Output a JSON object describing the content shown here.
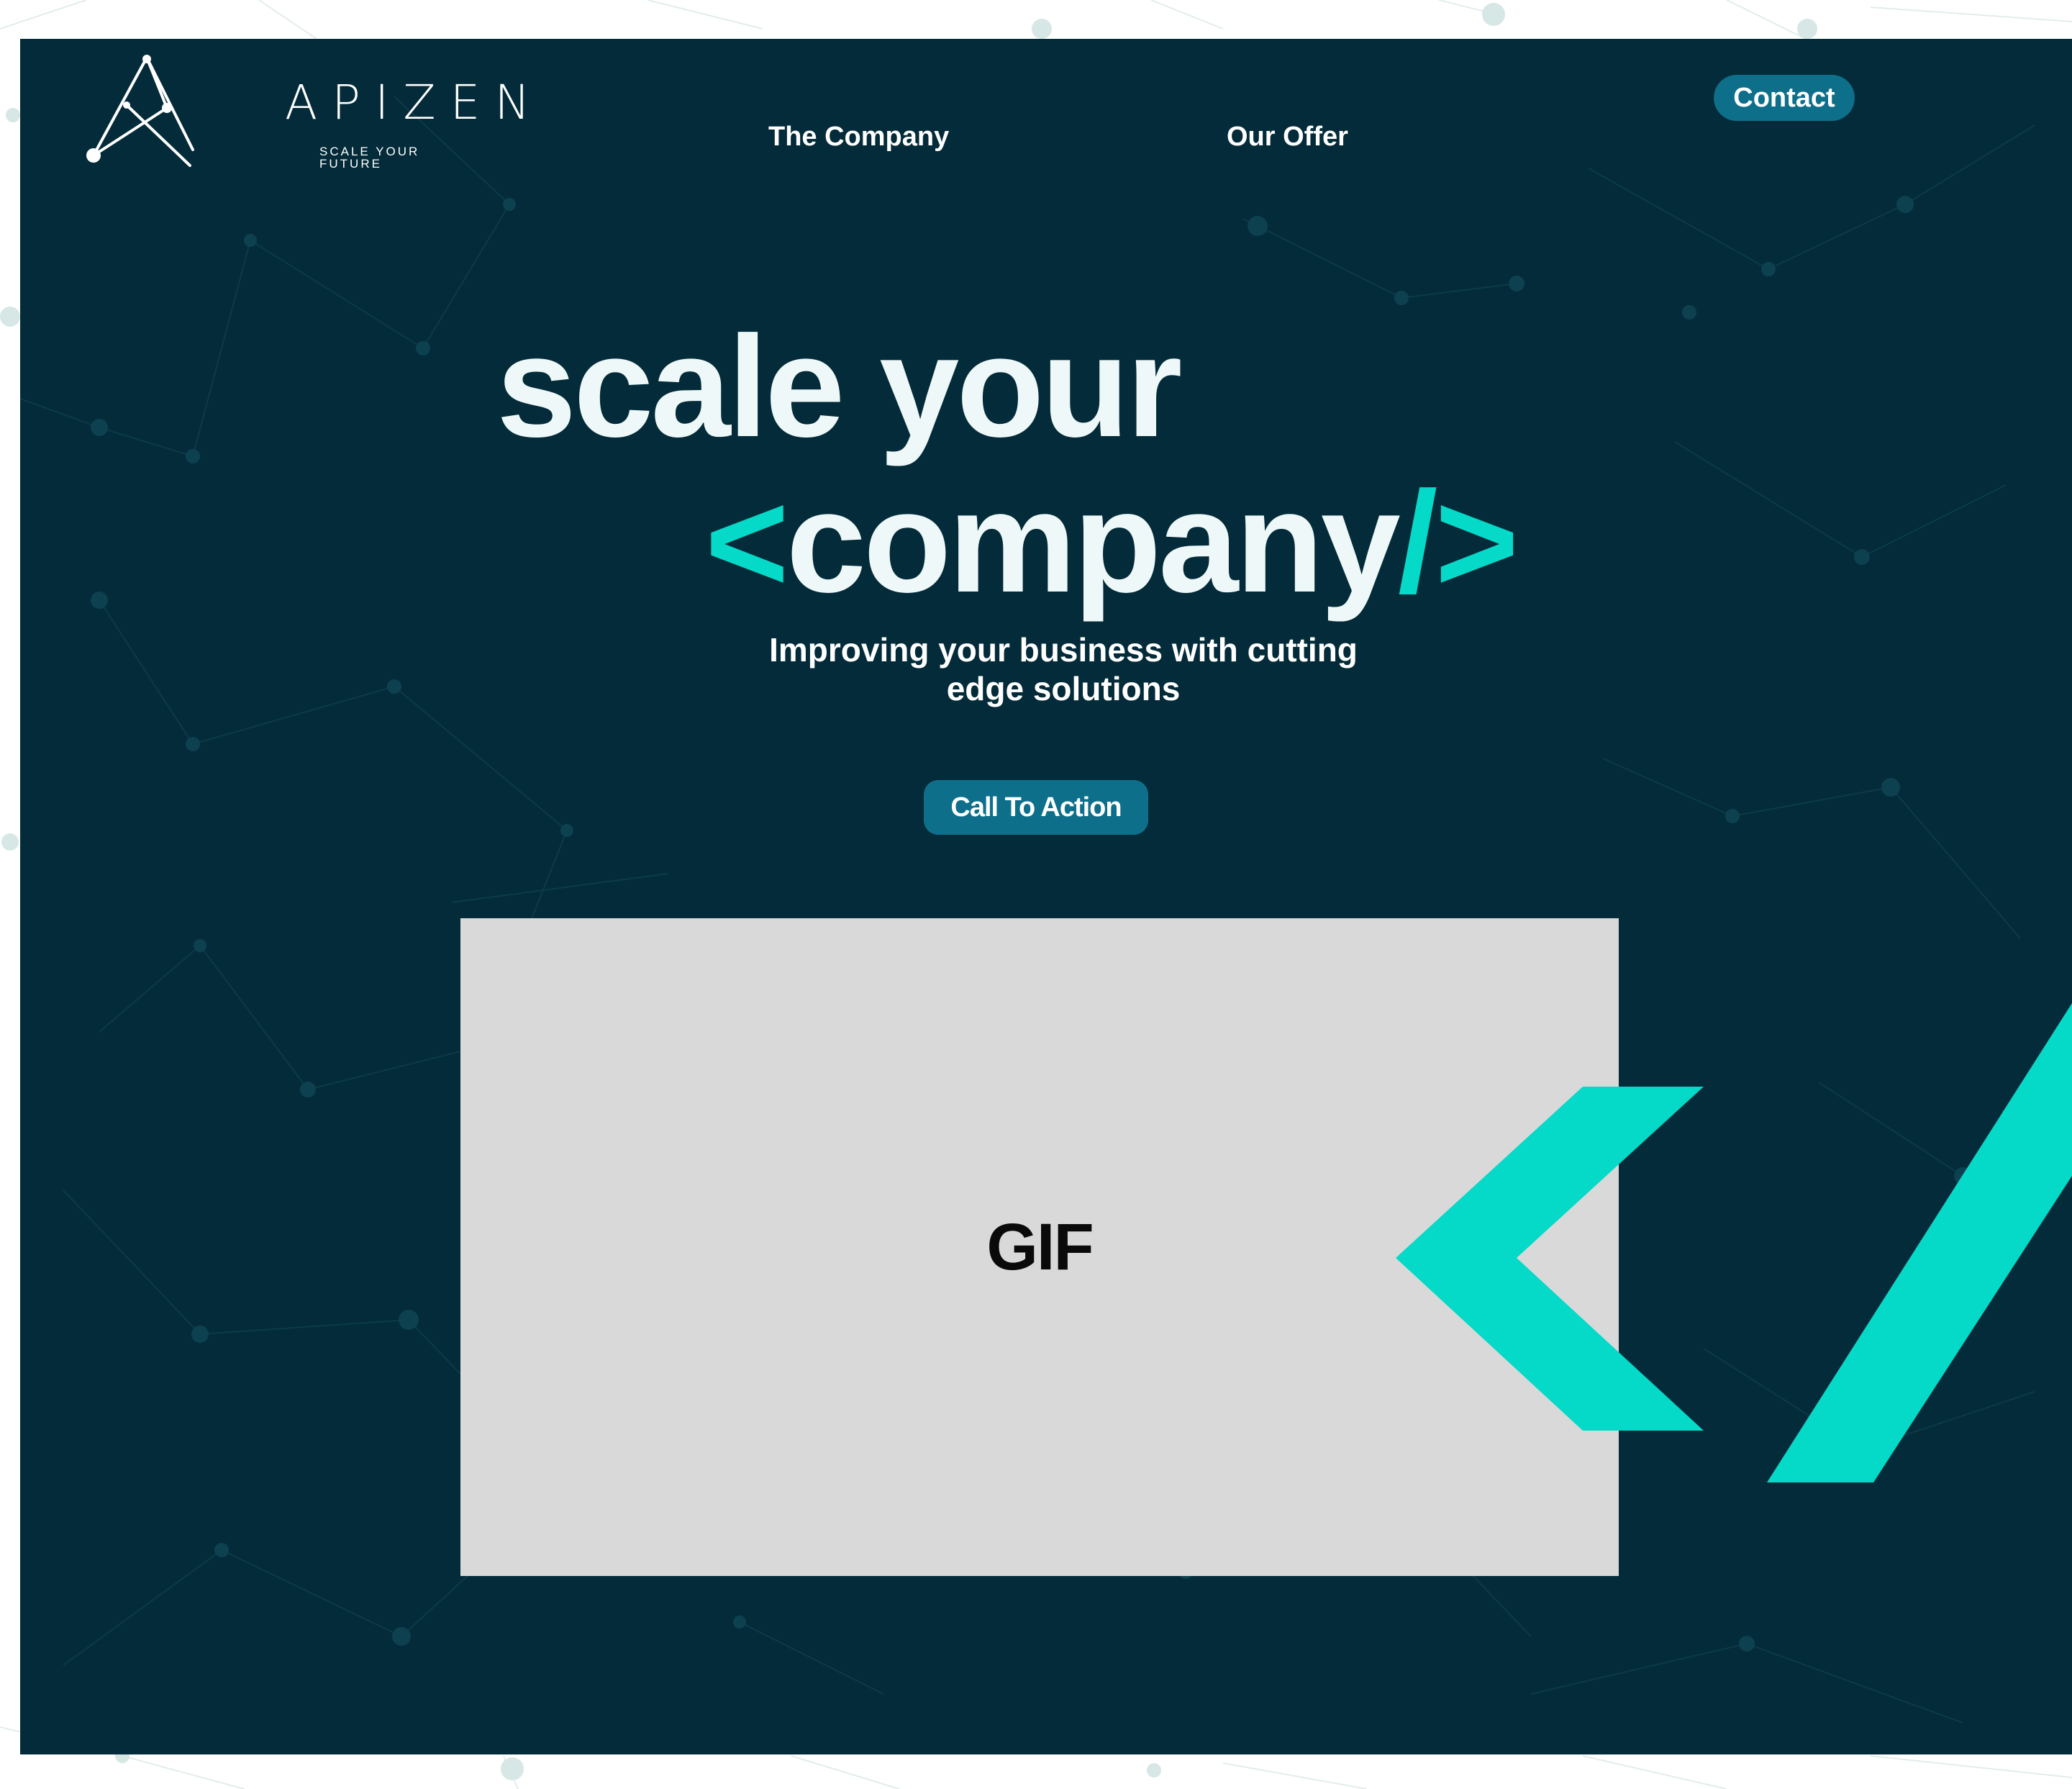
{
  "brand": {
    "name": "APIZEN",
    "tagline": "SCALE YOUR FUTURE"
  },
  "nav": {
    "items": [
      {
        "label": "The Company"
      },
      {
        "label": "Our Offer"
      }
    ],
    "contact_label": "Contact"
  },
  "hero": {
    "line1": "scale your",
    "line2_open": "<",
    "line2_word": "company",
    "line2_slash": "/",
    "line2_close": ">",
    "subtitle_line1": "Improving your business with cutting",
    "subtitle_line2": "edge solutions",
    "cta_label": "Call To Action"
  },
  "media": {
    "placeholder_label": "GIF"
  },
  "colors": {
    "panel_background": "#042b39",
    "accent": "#05d9c8",
    "button": "#0e6f8a",
    "placeholder": "#d9d9d9"
  }
}
